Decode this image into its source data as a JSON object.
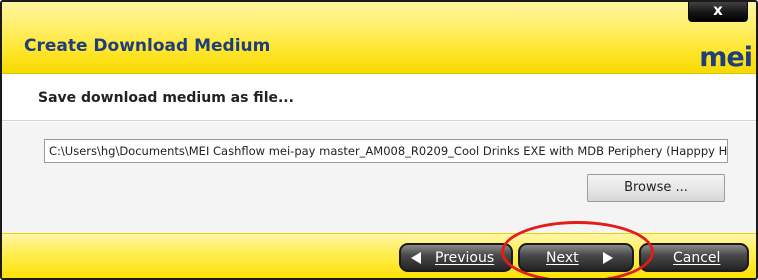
{
  "window": {
    "title": "Create Download Medium",
    "close_label": "x",
    "logo_text": "mei"
  },
  "section": {
    "header": "Save download medium as file..."
  },
  "form": {
    "path_value": "C:\\Users\\hg\\Documents\\MEI Cashflow mei-pay master_AM008_R0209_Cool Drinks EXE with MDB Periphery (Happpy Ha",
    "browse_label": "Browse ..."
  },
  "footer": {
    "previous_label": "Previous",
    "next_label": "Next",
    "cancel_label": "Cancel"
  },
  "colors": {
    "title_text": "#1f3e7c",
    "bar_yellow": "#ffe52a",
    "annotation_red": "#e21b1b"
  },
  "icons": {
    "previous": "arrow-left-icon",
    "next": "arrow-right-icon"
  }
}
